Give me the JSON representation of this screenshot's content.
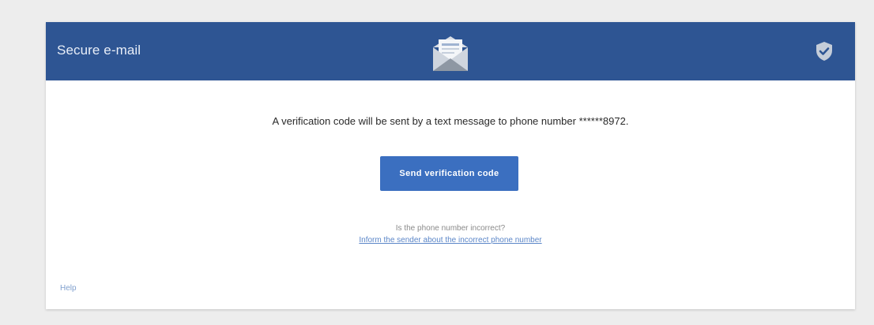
{
  "header": {
    "title": "Secure e-mail",
    "center_icon": "envelope-open-icon",
    "right_icon": "shield-check-icon",
    "background_color": "#2e5593"
  },
  "main": {
    "message": "A verification code will be sent by a text message to phone number ******8972.",
    "send_button_label": "Send verification code",
    "question": "Is the phone number incorrect?",
    "inform_link_label": "Inform the sender about the incorrect phone number",
    "accent_color": "#3b6fc0"
  },
  "footer": {
    "help_label": "Help"
  }
}
